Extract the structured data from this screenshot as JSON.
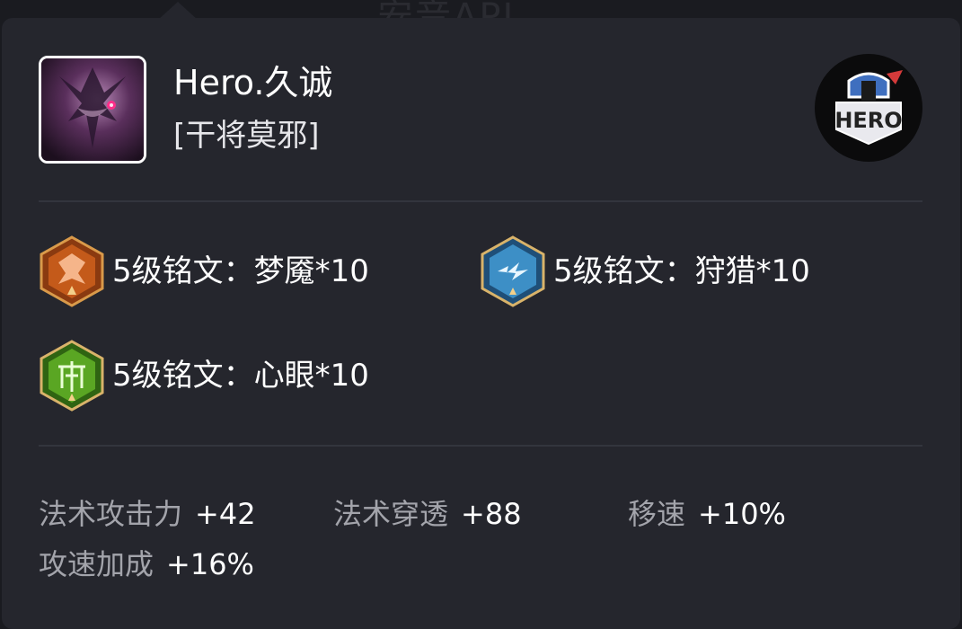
{
  "player": {
    "name": "Hero.久诚",
    "hero": "[干将莫邪]",
    "team_logo_text": "HERO"
  },
  "runes": [
    {
      "label": "5级铭文：梦魇*10",
      "icon": "nightmare-rune-icon",
      "color": "#c45a1a"
    },
    {
      "label": "5级铭文：狩猎*10",
      "icon": "hunt-rune-icon",
      "color": "#3d8fc6"
    },
    {
      "label": "5级铭文：心眼*10",
      "icon": "insight-rune-icon",
      "color": "#5aa623"
    }
  ],
  "stats": [
    {
      "label": "法术攻击力",
      "value": "+42"
    },
    {
      "label": "法术穿透",
      "value": "+88"
    },
    {
      "label": "移速",
      "value": "+10%"
    },
    {
      "label": "攻速加成",
      "value": "+16%"
    }
  ],
  "colors": {
    "card_bg": "#25262d",
    "page_bg": "#1a1b20",
    "text_primary": "#ffffff",
    "text_secondary": "#a3a4ab",
    "divider": "#33353d"
  }
}
